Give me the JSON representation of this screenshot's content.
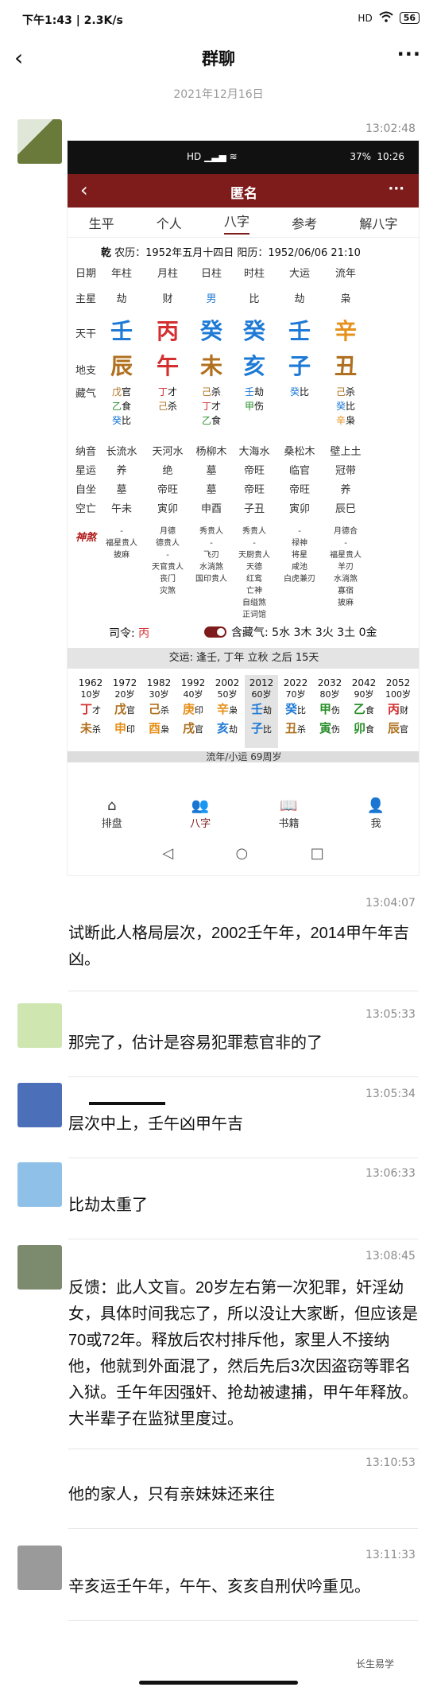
{
  "status_bar": {
    "time_speed": "下午1:43 | 2.3K/s",
    "mute_icon": "bell-off-icon",
    "signal": "HD",
    "battery": "56"
  },
  "nav": {
    "title": "群聊",
    "back": "‹",
    "more": "···"
  },
  "date_separator": "2021年12月16日",
  "messages": [
    {
      "time": "13:02:48",
      "type": "image"
    },
    {
      "time": "13:04:07",
      "text": "试断此人格局层次，2002壬午年，2014甲午年吉凶。"
    },
    {
      "time": "13:05:33",
      "text": "那完了，估计是容易犯罪惹官非的了"
    },
    {
      "time": "13:05:34",
      "text": "层次中上，壬午凶甲午吉"
    },
    {
      "time": "13:06:33",
      "text": "比劫太重了"
    },
    {
      "time": "13:08:45",
      "text": "反馈：此人文盲。20岁左右第一次犯罪，奸淫幼女，具体时间我忘了，所以没让大家断，但应该是70或72年。释放后农村排斥他，家里人不接纳他，他就到外面混了，然后先后3次因盗窃等罪名入狱。壬午年因强奸、抢劫被逮捕，甲午年释放。大半辈子在监狱里度过。"
    },
    {
      "time": "13:10:53",
      "text": "他的家人，只有亲妹妹还来往"
    },
    {
      "time": "13:11:33",
      "text": "辛亥运壬午年，午午、亥亥自刑伏吟重见。"
    }
  ],
  "screenshot": {
    "phone_status": {
      "battery": "37%",
      "time": "10:26"
    },
    "header": {
      "title": "匿名",
      "back": "‹",
      "more": "···"
    },
    "tabs": [
      "生平",
      "个人",
      "八字",
      "参考",
      "解八字"
    ],
    "active_tab": "八字",
    "birth": {
      "gender": "乾",
      "info": "农历：1952年五月十四日 阳历：1952/06/06 21:10"
    },
    "columns": [
      "年柱",
      "月柱",
      "日柱",
      "时柱",
      "大运",
      "流年"
    ],
    "row_labels": {
      "date": "日期",
      "main_star": "主星",
      "tiangan": "天干",
      "dizhi": "地支",
      "canggan": "藏气",
      "nayin": "纳音",
      "xingyun": "星运",
      "zizuo": "自坐",
      "kongwang": "空亡",
      "shensha": "神煞"
    },
    "main_star": [
      "劫",
      "财",
      "男",
      "比",
      "劫",
      "枭"
    ],
    "tiangan": [
      "壬",
      "丙",
      "癸",
      "癸",
      "壬",
      "辛"
    ],
    "dizhi": [
      "辰",
      "午",
      "未",
      "亥",
      "子",
      "丑"
    ],
    "canggan": [
      [
        "戊官",
        "乙食",
        "癸比"
      ],
      [
        "丁才",
        "己杀"
      ],
      [
        "己杀",
        "丁才",
        "乙食"
      ],
      [
        "壬劫",
        "甲伤"
      ],
      [
        "癸比"
      ],
      [
        "己杀",
        "癸比",
        "辛枭"
      ]
    ],
    "nayin": [
      "长流水",
      "天河水",
      "杨柳木",
      "大海水",
      "桑松木",
      "壁上土"
    ],
    "xingyun": [
      "养",
      "绝",
      "墓",
      "帝旺",
      "临官",
      "冠带"
    ],
    "zizuo": [
      "墓",
      "帝旺",
      "墓",
      "帝旺",
      "帝旺",
      "养"
    ],
    "kongwang": [
      "午未",
      "寅卯",
      "申酉",
      "子丑",
      "寅卯",
      "辰巳"
    ],
    "shensha": [
      [
        "-",
        "福星贵人",
        "披麻"
      ],
      [
        "月德",
        "德贵人",
        "-",
        "天官贵人",
        "丧门",
        "灾煞"
      ],
      [
        "秀贵人",
        "-",
        "飞刃",
        "水淌煞",
        "国印贵人"
      ],
      [
        "秀贵人",
        "-",
        "天厨贵人",
        "天德",
        "红鸾",
        "亡神",
        "自缢煞",
        "正词馆"
      ],
      [
        "-",
        "禄神",
        "将星",
        "咸池",
        "白虎兼刃"
      ],
      [
        "月德合",
        "-",
        "福星贵人",
        "羊刃",
        "水淌煞",
        "寡宿",
        "披麻"
      ]
    ],
    "siling": {
      "label": "司令:",
      "value": "丙"
    },
    "canggan_toggle": {
      "label": "含藏气",
      "value": "5水 3木 3火 3土 0金"
    },
    "jiaoyun": "交运: 逢壬, 丁年 立秋 之后 15天",
    "dayun": [
      {
        "year": "1962",
        "age": "10岁",
        "gan": "丁",
        "gan_s": "才",
        "zhi": "未",
        "zhi_s": "杀"
      },
      {
        "year": "1972",
        "age": "20岁",
        "gan": "戊",
        "gan_s": "官",
        "zhi": "申",
        "zhi_s": "印"
      },
      {
        "year": "1982",
        "age": "30岁",
        "gan": "己",
        "gan_s": "杀",
        "zhi": "酉",
        "zhi_s": "枭"
      },
      {
        "year": "1992",
        "age": "40岁",
        "gan": "庚",
        "gan_s": "印",
        "zhi": "戌",
        "zhi_s": "官"
      },
      {
        "year": "2002",
        "age": "50岁",
        "gan": "辛",
        "gan_s": "枭",
        "zhi": "亥",
        "zhi_s": "劫"
      },
      {
        "year": "2012",
        "age": "60岁",
        "gan": "壬",
        "gan_s": "劫",
        "zhi": "子",
        "zhi_s": "比"
      },
      {
        "year": "2022",
        "age": "70岁",
        "gan": "癸",
        "gan_s": "比",
        "zhi": "丑",
        "zhi_s": "杀"
      },
      {
        "year": "2032",
        "age": "80岁",
        "gan": "甲",
        "gan_s": "伤",
        "zhi": "寅",
        "zhi_s": "伤"
      },
      {
        "year": "2042",
        "age": "90岁",
        "gan": "乙",
        "gan_s": "食",
        "zhi": "卯",
        "zhi_s": "食"
      },
      {
        "year": "2052",
        "age": "100岁",
        "gan": "丙",
        "gan_s": "财",
        "zhi": "辰",
        "zhi_s": "官"
      }
    ],
    "liunian_bar": "流年/小运 69周岁",
    "bottom_nav": [
      "排盘",
      "八字",
      "书籍",
      "我"
    ]
  },
  "watermark": "长生易学"
}
